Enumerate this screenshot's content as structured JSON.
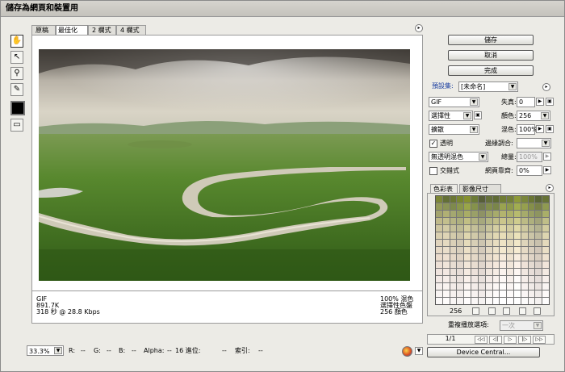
{
  "window": {
    "title": "儲存為網頁和裝置用"
  },
  "tabs": [
    "原稿",
    "最佳化",
    "2 欄式",
    "4 欄式"
  ],
  "tools": [
    "hand-icon",
    "slice-select-icon",
    "zoom-icon",
    "eyedropper-icon"
  ],
  "preview_info": {
    "format": "GIF",
    "size": "891.7K",
    "time": "318 秒 @ 28.8 Kbps",
    "quality": "100% 混色",
    "palette": "選擇性色盤",
    "colors": "256 顏色"
  },
  "bottom": {
    "zoom": "33.3%",
    "r": "R:",
    "r_val": "--",
    "g": "G:",
    "g_val": "--",
    "b": "B:",
    "b_val": "--",
    "alpha": "Alpha:",
    "alpha_val": "--",
    "hex": "16 進位:",
    "hex_val": "--",
    "index": "索引:",
    "index_val": "--"
  },
  "buttons": {
    "save": "儲存",
    "cancel": "取消",
    "done": "完成",
    "device_central": "Device Central..."
  },
  "settings": {
    "preset_label": "預設集:",
    "preset_value": "[未命名]",
    "format": "GIF",
    "lossy_label": "失真:",
    "lossy": "0",
    "palette": "選擇性",
    "colors_label": "顏色:",
    "colors": "256",
    "dither": "擴散",
    "dither_amt_label": "混色:",
    "dither_amt": "100%",
    "transparency": "透明",
    "transparency_checked": true,
    "matte_label": "邊緣調合:",
    "matte": "",
    "trans_dither": "無透明混色",
    "amount_label": "總量:",
    "amount": "100%",
    "interlaced": "交錯式",
    "interlaced_checked": false,
    "web_snap_label": "網頁靠齊:",
    "web_snap": "0%"
  },
  "color_panel": {
    "tabs": [
      "色彩表",
      "影像尺寸"
    ],
    "count": "256"
  },
  "animation": {
    "loop_label": "重複播放選項:",
    "loop_value": "一次",
    "frame": "1/1"
  },
  "palette_colors": [
    "#7c8636",
    "#636f36",
    "#6b7633",
    "#798630",
    "#86912f",
    "#6c7b37",
    "#575e38",
    "#65703a",
    "#5f6b34",
    "#707c34",
    "#737f39",
    "#8e9a3a",
    "#7a863b",
    "#6a7634",
    "#5a6536",
    "#677336",
    "#949a58",
    "#8b9456",
    "#7e8a4c",
    "#89964a",
    "#99a548",
    "#85924b",
    "#737c4e",
    "#828d4b",
    "#7a8649",
    "#9aa34f",
    "#8e9a4b",
    "#a1ad50",
    "#96a04e",
    "#858f49",
    "#7a8247",
    "#8f9a51",
    "#a3a36e",
    "#b0af74",
    "#a4a870",
    "#99a067",
    "#a9ad66",
    "#9aa068",
    "#8e9265",
    "#9ea368",
    "#a7ab6b",
    "#b3b46e",
    "#acb069",
    "#b7bb6e",
    "#a6ab6b",
    "#989e63",
    "#8e9560",
    "#a9ae69",
    "#bfb98a",
    "#c3bf8d",
    "#b6b584",
    "#aeb07f",
    "#c1bf84",
    "#b2b282",
    "#a6a87d",
    "#b5b685",
    "#c1be89",
    "#cbc68c",
    "#c2c088",
    "#cfcc8e",
    "#bcbb85",
    "#aeb07e",
    "#a3a47a",
    "#c0be88",
    "#cdc5a0",
    "#d2cba5",
    "#c5c09a",
    "#bdbb94",
    "#d1cc9d",
    "#c4c099",
    "#b8b693",
    "#c8c49c",
    "#d4cea2",
    "#ddd6a6",
    "#d2cca0",
    "#e0d9a8",
    "#cdc89e",
    "#bebc96",
    "#b3b290",
    "#d2cc9f",
    "#d9cfb0",
    "#ded4b5",
    "#d3cbab",
    "#cbc4a6",
    "#ded6ae",
    "#d1caa9",
    "#c6c0a3",
    "#d6cfad",
    "#e1d8b3",
    "#e8deb8",
    "#ddd5b0",
    "#ebe2ba",
    "#d8d0ae",
    "#cbc5a7",
    "#c1bca1",
    "#ddd5b0",
    "#e0d4bd",
    "#e5dac1",
    "#dad0b8",
    "#d2c9b3",
    "#e5dbbb",
    "#d8cfb6",
    "#cdc5b0",
    "#ded4ba",
    "#e8ddc0",
    "#eee3c5",
    "#e4dabd",
    "#f1e7c8",
    "#dfd5bb",
    "#d3cab3",
    "#c9c1ad",
    "#e4dabc",
    "#e6d9c6",
    "#eadecb",
    "#e0d5c2",
    "#d9cfbd",
    "#ebdfc6",
    "#dfd4c0",
    "#d4cabb",
    "#e4d9c4",
    "#ede2ca",
    "#f3e8cf",
    "#eadfc7",
    "#f6ebd2",
    "#e6dac5",
    "#dacfbe",
    "#d1c6b8",
    "#eadfc6",
    "#eadbcc",
    "#eee0d1",
    "#e5d8c8",
    "#dfd3c4",
    "#efe2cd",
    "#e4d8c7",
    "#dad0c2",
    "#e9dccb",
    "#f1e4d1",
    "#f6eadb",
    "#eee2d0",
    "#f8ede0",
    "#eadece",
    "#e0d4c6",
    "#d8cdc0",
    "#eee2d0",
    "#ece0d6",
    "#f0e5da",
    "#e8ddd2",
    "#e3d8ce",
    "#f2e6d8",
    "#e8ddd1",
    "#dfd5cc",
    "#ede1d6",
    "#f4e8dc",
    "#f9eee5",
    "#f1e6da",
    "#fbf1e9",
    "#eee2d8",
    "#e4dad1",
    "#dcd2ca",
    "#f1e5da",
    "#efe4de",
    "#f3e8e2",
    "#ebe1da",
    "#e6dcd6",
    "#f5eae1",
    "#ece1da",
    "#e3d9d3",
    "#f0e6de",
    "#f6ece4",
    "#fbf3ee",
    "#f4eae2",
    "#fdf6f2",
    "#f1e7e0",
    "#e8ded9",
    "#e0d7d2",
    "#f4eae2",
    "#f2e9e5",
    "#f6ede9",
    "#eee6e1",
    "#eae1dd",
    "#f8efea",
    "#efe6e2",
    "#e7dfdb",
    "#f3eae6",
    "#f9f1ed",
    "#fdf8f6",
    "#f7efeb",
    "#fefbfa",
    "#f4ece8",
    "#ece4e0",
    "#e5ddda",
    "#f7efeb",
    "#f5efec",
    "#f9f3f0",
    "#f2ebe8",
    "#eee7e4",
    "#fbf5f2",
    "#f3ece9",
    "#ece5e2",
    "#f6f0ed",
    "#fcf7f5",
    "#fefcfb",
    "#faf5f3",
    "#fffefd",
    "#f7f1ef",
    "#f0eae7",
    "#eae3e0",
    "#faf5f3",
    "#f8f4f2",
    "#fcf8f6",
    "#f6f1ef",
    "#f2edeb",
    "#fdfaf8",
    "#f7f2f0",
    "#f1ebe9",
    "#f9f5f3",
    "#fefbfa",
    "#fffefe",
    "#fdfaf9",
    "#fffffe",
    "#faf6f5",
    "#f5f0ee",
    "#efeae8",
    "#fdfaf9",
    "#fbf9f8",
    "#fefcfb",
    "#f9f6f5",
    "#f6f3f2",
    "#fffdfd",
    "#faf7f6",
    "#f5f2f1",
    "#fcfaf9",
    "#fffefe",
    "#ffffff",
    "#fefdfd",
    "#ffffff",
    "#fcfbfa",
    "#f8f6f5",
    "#f4f1f0",
    "#fefdfd"
  ]
}
